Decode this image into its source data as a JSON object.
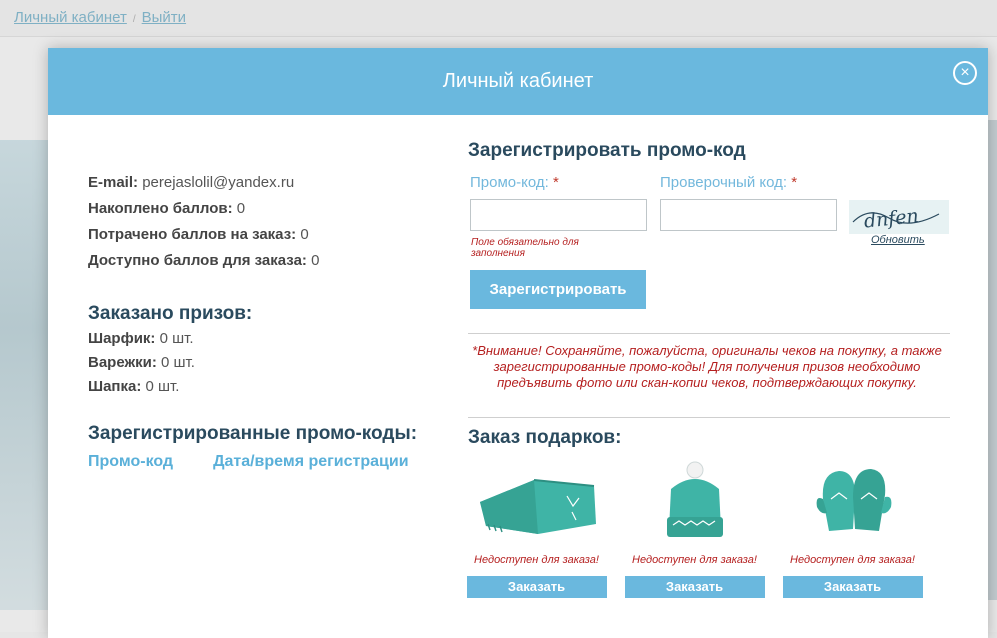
{
  "top_links": {
    "cabinet": "Личный кабинет",
    "logout": "Выйти"
  },
  "modal": {
    "title": "Личный кабинет",
    "close_glyph": "×"
  },
  "account": {
    "email_label": "E-mail:",
    "email_value": "perejaslolil@yandex.ru",
    "accumulated_label": "Накоплено баллов:",
    "accumulated_value": "0",
    "spent_label": "Потрачено баллов на заказ:",
    "spent_value": "0",
    "available_label": "Доступно баллов для заказа:",
    "available_value": "0"
  },
  "prizes": {
    "title": "Заказано призов:",
    "items": [
      {
        "label": "Шарфик:",
        "value": "0 шт."
      },
      {
        "label": "Варежки:",
        "value": "0 шт."
      },
      {
        "label": "Шапка:",
        "value": "0 шт."
      }
    ]
  },
  "codes": {
    "title": "Зарегистрированные промо-коды:",
    "col1": "Промо-код",
    "col2": "Дата/время регистрации"
  },
  "register": {
    "title": "Зарегистрировать промо-код",
    "promo_label": "Промо-код:",
    "check_label": "Проверочный код:",
    "required": "*",
    "error": "Поле обязательно для заполнения",
    "captcha_text": "dnfen",
    "refresh": "Обновить",
    "button": "Зарегистрировать",
    "warning": "*Внимание! Сохраняйте, пожалуйста, оригиналы чеков на покупку, а также зарегистрированные промо-коды! Для получения призов необходимо предъявить фото или скан-копии чеков, подтверждающих покупку."
  },
  "gifts": {
    "title": "Заказ подарков:",
    "items": [
      {
        "icon": "scarf-icon",
        "status": "Недоступен для заказа!",
        "button": "Заказать"
      },
      {
        "icon": "hat-icon",
        "status": "Недоступен для заказа!",
        "button": "Заказать"
      },
      {
        "icon": "mittens-icon",
        "status": "Недоступен для заказа!",
        "button": "Заказать"
      }
    ]
  },
  "colors": {
    "accent": "#6ab8de",
    "error": "#b51f1f",
    "heading": "#2a4a5e",
    "gift": "#3fb4a6"
  }
}
